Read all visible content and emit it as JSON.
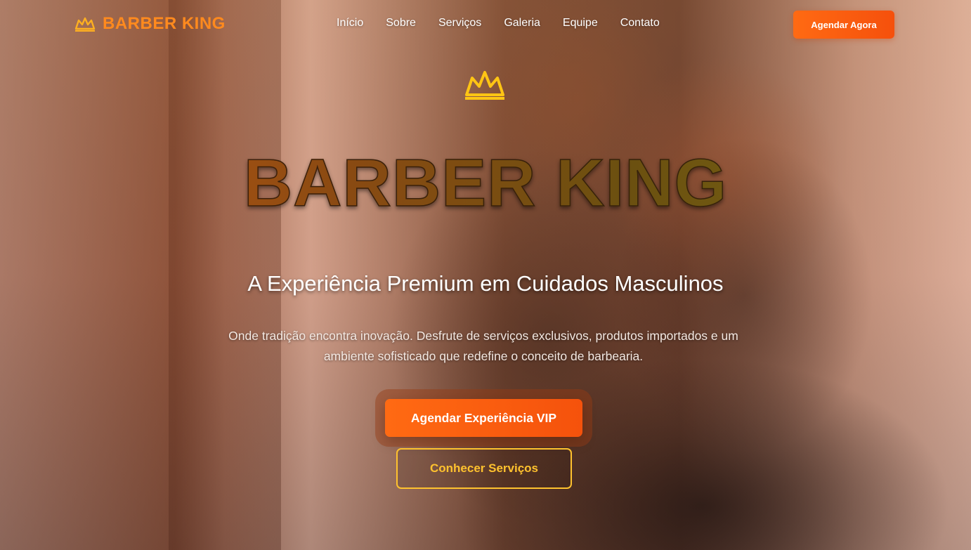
{
  "brand": {
    "name": "BARBER KING",
    "logo_icon": "crown-icon",
    "accent_color": "#ff8a1e",
    "secondary_color": "#ffc22e"
  },
  "nav": {
    "items": [
      {
        "label": "Início"
      },
      {
        "label": "Sobre"
      },
      {
        "label": "Serviços"
      },
      {
        "label": "Galeria"
      },
      {
        "label": "Equipe"
      },
      {
        "label": "Contato"
      }
    ],
    "cta_label": "Agendar Agora"
  },
  "hero": {
    "icon": "crown-icon",
    "title": "BARBER KING",
    "subtitle": "A Experiência Premium em Cuidados Masculinos",
    "description": "Onde tradição encontra inovação. Desfrute de serviços exclusivos, produtos importados e um ambiente sofisticado que redefine o conceito de barbearia.",
    "primary_button": "Agendar Experiência VIP",
    "secondary_button": "Conhecer Serviços"
  }
}
